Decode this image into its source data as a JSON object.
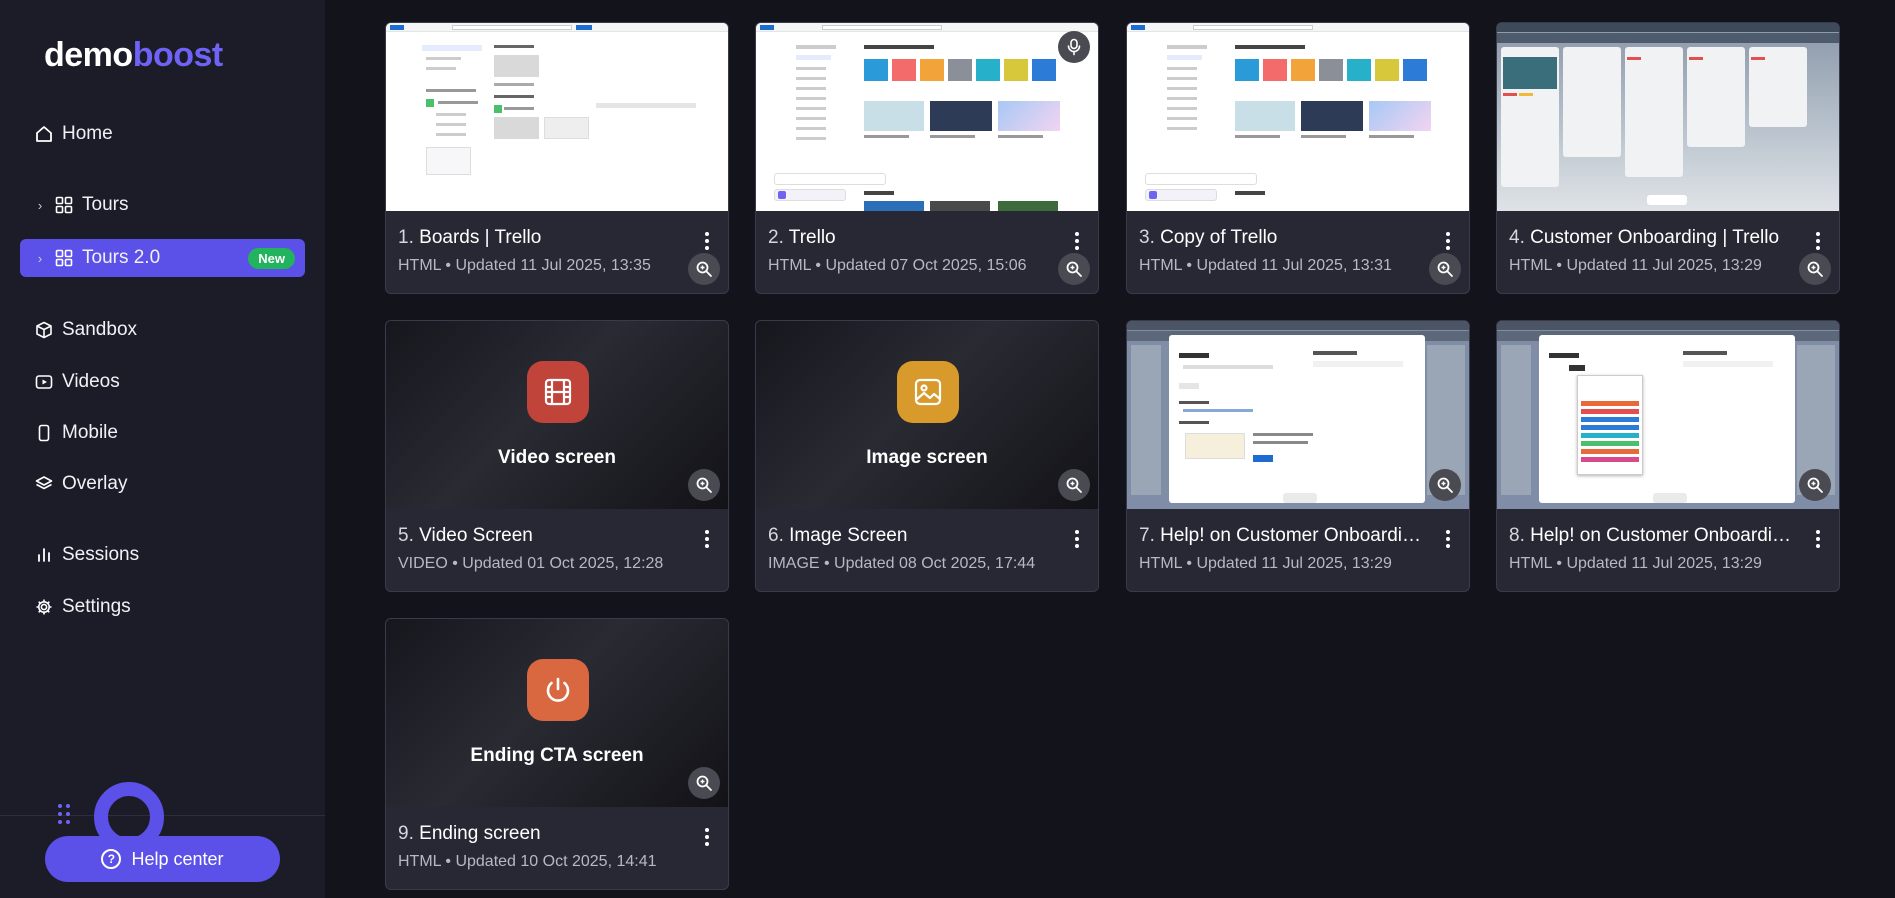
{
  "brand": {
    "part1": "demo",
    "part2": "boost"
  },
  "sidebar": {
    "groups": [
      [
        {
          "label": "Home",
          "icon": "home-icon"
        }
      ],
      [
        {
          "label": "Tours",
          "icon": "grid-icon",
          "chevron": true
        },
        {
          "label": "Tours 2.0",
          "icon": "grid-icon",
          "chevron": true,
          "active": true,
          "badge": "New"
        }
      ],
      [
        {
          "label": "Sandbox",
          "icon": "cube-icon"
        },
        {
          "label": "Videos",
          "icon": "play-icon"
        },
        {
          "label": "Mobile",
          "icon": "mobile-icon"
        },
        {
          "label": "Overlay",
          "icon": "layers-icon"
        }
      ],
      [
        {
          "label": "Sessions",
          "icon": "bar-chart-icon"
        },
        {
          "label": "Settings",
          "icon": "gear-icon"
        }
      ]
    ],
    "help_center": "Help center"
  },
  "cards": [
    {
      "num": "1.",
      "title": "Boards | Trello",
      "meta": "HTML • Updated 11 Jul 2025, 13:35",
      "thumb": "trello-boards"
    },
    {
      "num": "2.",
      "title": "Trello",
      "meta": "HTML • Updated 07 Oct 2025, 15:06",
      "thumb": "trello-templates",
      "mic": true
    },
    {
      "num": "3.",
      "title": "Copy of Trello",
      "meta": "HTML • Updated 11 Jul 2025, 13:31",
      "thumb": "trello-templates"
    },
    {
      "num": "4.",
      "title": "Customer Onboarding | Trello",
      "meta": "HTML • Updated 11 Jul 2025, 13:29",
      "thumb": "trello-board-view"
    },
    {
      "num": "5.",
      "title": "Video Screen",
      "meta": "VIDEO • Updated 01 Oct 2025, 12:28",
      "thumb": "video",
      "screen_label": "Video screen",
      "icon_color": "#c0443a"
    },
    {
      "num": "6.",
      "title": "Image Screen",
      "meta": "IMAGE • Updated 08 Oct 2025, 17:44",
      "thumb": "image",
      "screen_label": "Image screen",
      "icon_color": "#d89a2a"
    },
    {
      "num": "7.",
      "title": "Help! on Customer Onboarding | Trello",
      "meta": "HTML • Updated 11 Jul 2025, 13:29",
      "thumb": "trello-card-modal"
    },
    {
      "num": "8.",
      "title": "Help! on Customer Onboarding | Trello",
      "meta": "HTML • Updated 11 Jul 2025, 13:29",
      "thumb": "trello-card-labels"
    },
    {
      "num": "9.",
      "title": "Ending screen",
      "meta": "HTML • Updated 10 Oct 2025, 14:41",
      "thumb": "ending",
      "screen_label": "Ending CTA screen",
      "icon_color": "#d9673f"
    }
  ],
  "colors": {
    "accent": "#5b50e8",
    "badge": "#22b35e",
    "bg": "#13131c",
    "sidebar": "#1c1c28",
    "card": "#282834"
  }
}
